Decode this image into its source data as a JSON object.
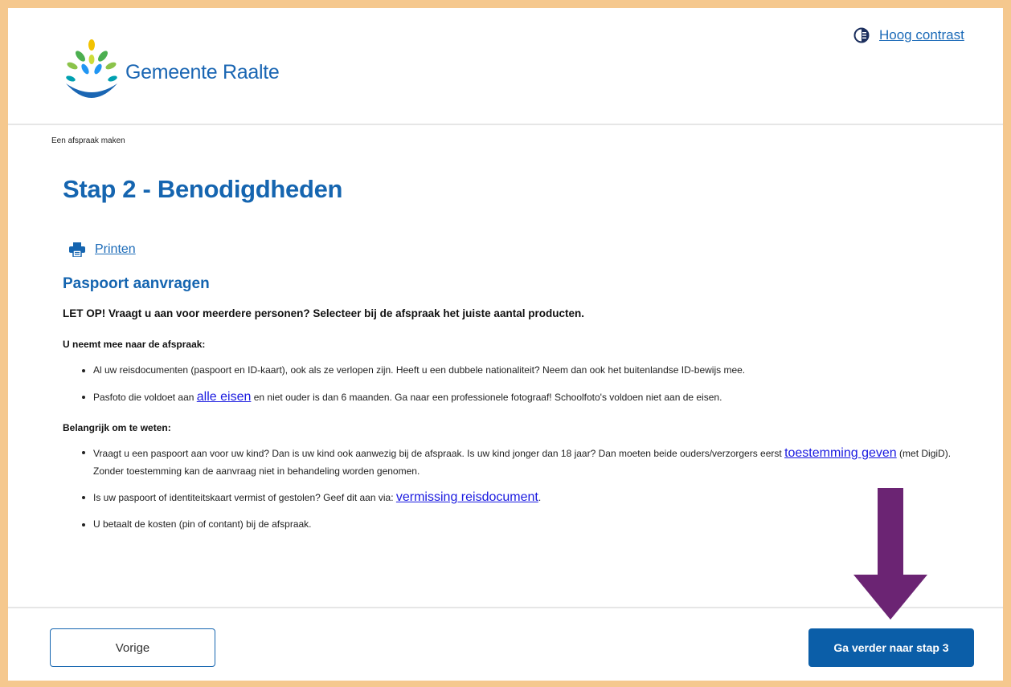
{
  "header": {
    "org_name": "Gemeente Raalte",
    "contrast_label": "Hoog contrast"
  },
  "breadcrumb": "Een afspraak maken",
  "page_title": "Stap 2 - Benodigdheden",
  "print_label": "Printen",
  "section": {
    "title": "Paspoort aanvragen",
    "warning": "LET OP! Vraagt u aan voor meerdere personen? Selecteer bij de afspraak het juiste aantal producten.",
    "bring_heading": "U neemt mee naar de afspraak:",
    "bring_items": {
      "item1": "Al uw reisdocumenten (paspoort en ID-kaart), ook als ze verlopen zijn. Heeft u een dubbele nationaliteit? Neem dan ook het buitenlandse ID-bewijs mee.",
      "item2_before": "Pasfoto die voldoet aan ",
      "item2_link": "alle eisen",
      "item2_after": " en niet ouder is dan 6 maanden. Ga naar een professionele fotograaf! Schoolfoto's voldoen niet aan de eisen."
    },
    "know_heading": "Belangrijk om te weten:",
    "know_items": {
      "item1_before": "Vraagt u een paspoort aan voor uw kind? Dan is uw kind ook aanwezig bij de afspraak. Is uw kind jonger dan 18 jaar? Dan moeten beide ouders/verzorgers eerst ",
      "item1_link": "toestemming geven",
      "item1_after": " (met DigiD). Zonder toestemming kan de aanvraag niet in behandeling worden genomen.",
      "item2_before": "Is uw paspoort of identiteitskaart vermist of gestolen? Geef dit aan via: ",
      "item2_link": "vermissing reisdocument",
      "item2_after": ".",
      "item3": "U betaalt de kosten (pin of contant) bij de afspraak."
    }
  },
  "footer": {
    "prev_label": "Vorige",
    "next_label": "Ga verder naar stap 3"
  },
  "colors": {
    "page_border": "#f5c88e",
    "brand_blue": "#1565b0",
    "link_blue": "#1a1ae0",
    "button_blue": "#0b5ea8",
    "arrow_purple": "#6b2473"
  },
  "icons": {
    "contrast": "contrast-icon",
    "print": "printer-icon",
    "logo": "logo-icon",
    "arrow": "arrow-down-icon"
  }
}
